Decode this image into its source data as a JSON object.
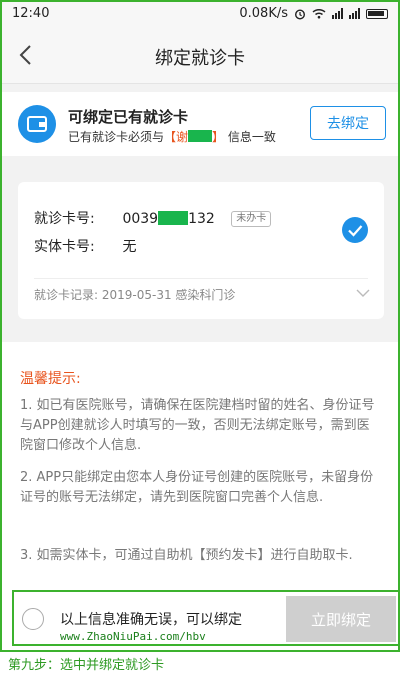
{
  "status_bar": {
    "time": "12:40",
    "speed": "0.08K/s"
  },
  "header": {
    "title": "绑定就诊卡"
  },
  "bind_existing": {
    "title": "可绑定已有就诊卡",
    "subtitle_prefix": "已有就诊卡必须与",
    "subtitle_name_open": "【谢",
    "subtitle_name_close": "】",
    "subtitle_suffix": "信息一致",
    "button": "去绑定"
  },
  "card": {
    "card_no_label": "就诊卡号:",
    "card_no_prefix": "0039",
    "card_no_suffix": "132",
    "status_tag": "未办卡",
    "physical_label": "实体卡号:",
    "physical_value": "无",
    "record": "就诊卡记录: 2019-05-31 感染科门诊"
  },
  "tips": {
    "title": "温馨提示:",
    "items": [
      "1. 如已有医院账号，请确保在医院建档时留的姓名、身份证号与APP创建就诊人时填写的一致，否则无法绑定账号，需到医院窗口修改个人信息.",
      "2. APP只能绑定由您本人身份证号创建的医院账号，未留身份证号的账号无法绑定，请先到医院窗口完善个人信息.",
      "3. 如需实体卡，可通过自助机【预约发卡】进行自助取卡."
    ]
  },
  "bottom_bar": {
    "confirm_text": "以上信息准确无误，可以绑定",
    "watermark": "www.ZhaoNiuPai.com/hbv",
    "bind_button": "立即绑定"
  },
  "caption": "第九步：选中并绑定就诊卡",
  "colors": {
    "accent": "#1e90e6",
    "warning": "#e8541e",
    "mask": "#19b54d",
    "frame": "#3cb22e"
  }
}
